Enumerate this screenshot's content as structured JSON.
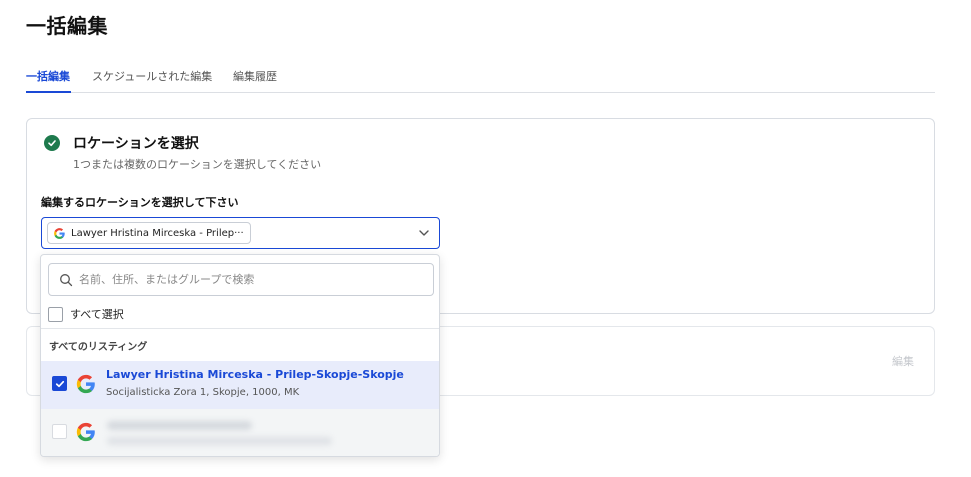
{
  "page": {
    "title": "一括編集"
  },
  "tabs": [
    {
      "label": "一括編集",
      "active": true
    },
    {
      "label": "スケジュールされた編集",
      "active": false
    },
    {
      "label": "編集履歴",
      "active": false
    }
  ],
  "step": {
    "title": "ロケーションを選択",
    "subtitle": "1つまたは複数のロケーションを選択してください",
    "field_label": "編集するロケーションを選択して下さい",
    "selected_chip": "Lawyer Hristina Mirceska - Prilep···"
  },
  "dropdown": {
    "search_placeholder": "名前、住所、またはグループで検索",
    "select_all_label": "すべて選択",
    "group_label": "すべてのリスティング",
    "items": [
      {
        "name": "Lawyer Hristina Mirceska - Prilep-Skopje-Skopje",
        "address": "Socijalisticka Zora 1, Skopje, 1000, MK",
        "checked": true
      },
      {
        "name": "",
        "address": "",
        "checked": false,
        "blurred": true
      }
    ]
  },
  "second_card": {
    "edit_label": "編集"
  },
  "colors": {
    "accent": "#1a49d6",
    "success": "#1e7a4d",
    "selected_row": "#e8ecfb"
  },
  "icons": [
    "check-circle-icon",
    "google-icon",
    "chevron-down-icon",
    "search-icon",
    "checkmark-icon"
  ]
}
